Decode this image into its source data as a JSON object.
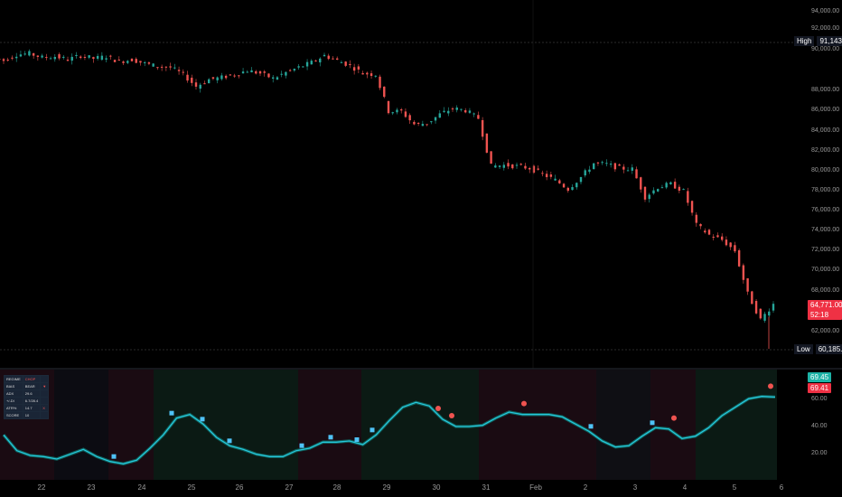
{
  "price_axis": {
    "labels": [
      "94,000.00",
      "92,000.00",
      "90,000.00",
      "88,000.00",
      "86,000.00",
      "84,000.00",
      "82,000.00",
      "80,000.00",
      "78,000.00",
      "76,000.00",
      "74,000.00",
      "72,000.00",
      "70,000.00",
      "68,000.00",
      "66,000.00",
      "62,000.00"
    ]
  },
  "high_tag": {
    "label": "High",
    "value": "91,143.38"
  },
  "low_tag": {
    "label": "Low",
    "value": "60,185.00"
  },
  "last_price_tag": {
    "price": "64,771.00",
    "countdown": "52:18"
  },
  "oscillator_axis": {
    "labels": [
      "60.00",
      "40.00",
      "20.00"
    ]
  },
  "oscillator_tags": {
    "teal_value": "69.45",
    "red_value": "69.41"
  },
  "time_axis": {
    "labels": [
      "22",
      "23",
      "24",
      "25",
      "26",
      "27",
      "28",
      "29",
      "30",
      "31",
      "Feb",
      "2",
      "3",
      "4",
      "5",
      "6"
    ]
  },
  "regime_table": {
    "rows": [
      {
        "k": "REGIME",
        "v": "CHOP",
        "x": ""
      },
      {
        "k": "BIAS",
        "v": "BEAR",
        "x": "▼"
      },
      {
        "k": "ADX",
        "v": "29.6",
        "x": ""
      },
      {
        "k": "+/-DI",
        "v": "6.7/28.4",
        "x": ""
      },
      {
        "k": "ATR%",
        "v": "14.7",
        "x": "X"
      },
      {
        "k": "SCORE",
        "v": "10",
        "x": ""
      }
    ]
  },
  "colors": {
    "bull": "#26a69a",
    "bear": "#ef5350",
    "oscillator_line": "#26c6da",
    "background": "#000000"
  },
  "chart_data": {
    "type": "candlestick",
    "x_labels": [
      "22",
      "23",
      "24",
      "25",
      "26",
      "27",
      "28",
      "29",
      "30",
      "31",
      "Feb",
      "2",
      "3",
      "4",
      "5",
      "6"
    ],
    "close_path_values": [
      89200,
      89800,
      89900,
      89500,
      89600,
      89300,
      89700,
      89400,
      89600,
      89100,
      89300,
      88900,
      88600,
      88500,
      87800,
      86600,
      87300,
      87500,
      87800,
      88200,
      87900,
      87400,
      88000,
      88500,
      89000,
      89700,
      89200,
      88700,
      87900,
      87800,
      84100,
      84100,
      82800,
      82900,
      83800,
      84400,
      84200,
      83400,
      78600,
      78700,
      78600,
      78400,
      77800,
      77200,
      76300,
      77500,
      78900,
      78800,
      78400,
      78300,
      75500,
      76500,
      76800,
      76100,
      72700,
      71700,
      71200,
      70100,
      65800,
      63200,
      64771
    ],
    "ylim": [
      60000,
      95000
    ],
    "oscillator": {
      "series": [
        {
          "values": [
            38,
            25,
            21,
            20,
            18,
            22,
            26,
            20,
            16,
            14,
            17,
            27,
            38,
            52,
            55,
            47,
            36,
            29,
            26,
            22,
            20,
            20,
            25,
            27,
            32,
            32,
            33,
            30,
            38,
            50,
            61,
            65,
            62,
            51,
            45,
            45,
            46,
            52,
            57,
            55,
            55,
            55,
            53,
            47,
            41,
            33,
            28,
            29,
            37,
            44,
            43,
            35,
            37,
            44,
            54,
            61,
            68,
            70,
            69.45
          ]
        }
      ],
      "ylim": [
        0,
        90
      ]
    }
  }
}
